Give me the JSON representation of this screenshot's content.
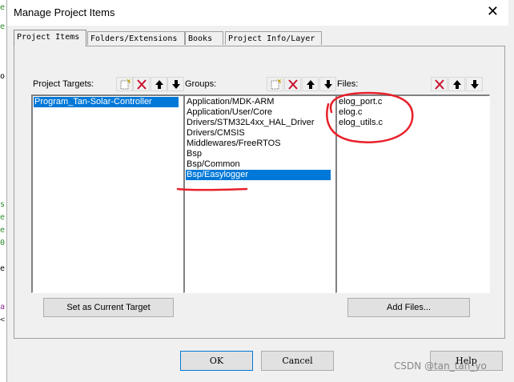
{
  "window": {
    "title": "Manage Project Items"
  },
  "tabs": [
    {
      "label": "Project Items"
    },
    {
      "label": "Folders/Extensions"
    },
    {
      "label": "Books"
    },
    {
      "label": "Project Info/Layer"
    }
  ],
  "targets": {
    "label": "Project Targets:",
    "items": [
      "Program_Tan-Solar-Controller"
    ],
    "selected": 0,
    "set_current_label": "Set as Current Target"
  },
  "groups": {
    "label": "Groups:",
    "items": [
      "Application/MDK-ARM",
      "Application/User/Core",
      "Drivers/STM32L4xx_HAL_Driver",
      "Drivers/CMSIS",
      "Middlewares/FreeRTOS",
      "Bsp",
      "Bsp/Common",
      "Bsp/Easylogger"
    ],
    "selected": 7
  },
  "files": {
    "label": "Files:",
    "items": [
      "elog_port.c",
      "elog.c",
      "elog_utils.c"
    ],
    "add_label": "Add Files..."
  },
  "buttons": {
    "ok": "OK",
    "cancel": "Cancel",
    "help": "Help"
  },
  "left_strip": [
    "e",
    "e",
    "o",
    "s",
    "e",
    "e",
    "0",
    "e",
    "a",
    "<"
  ],
  "watermark": "CSDN @tan_tan_yo",
  "colors": {
    "selection": "#0078d7",
    "annotation": "#e8202a"
  }
}
